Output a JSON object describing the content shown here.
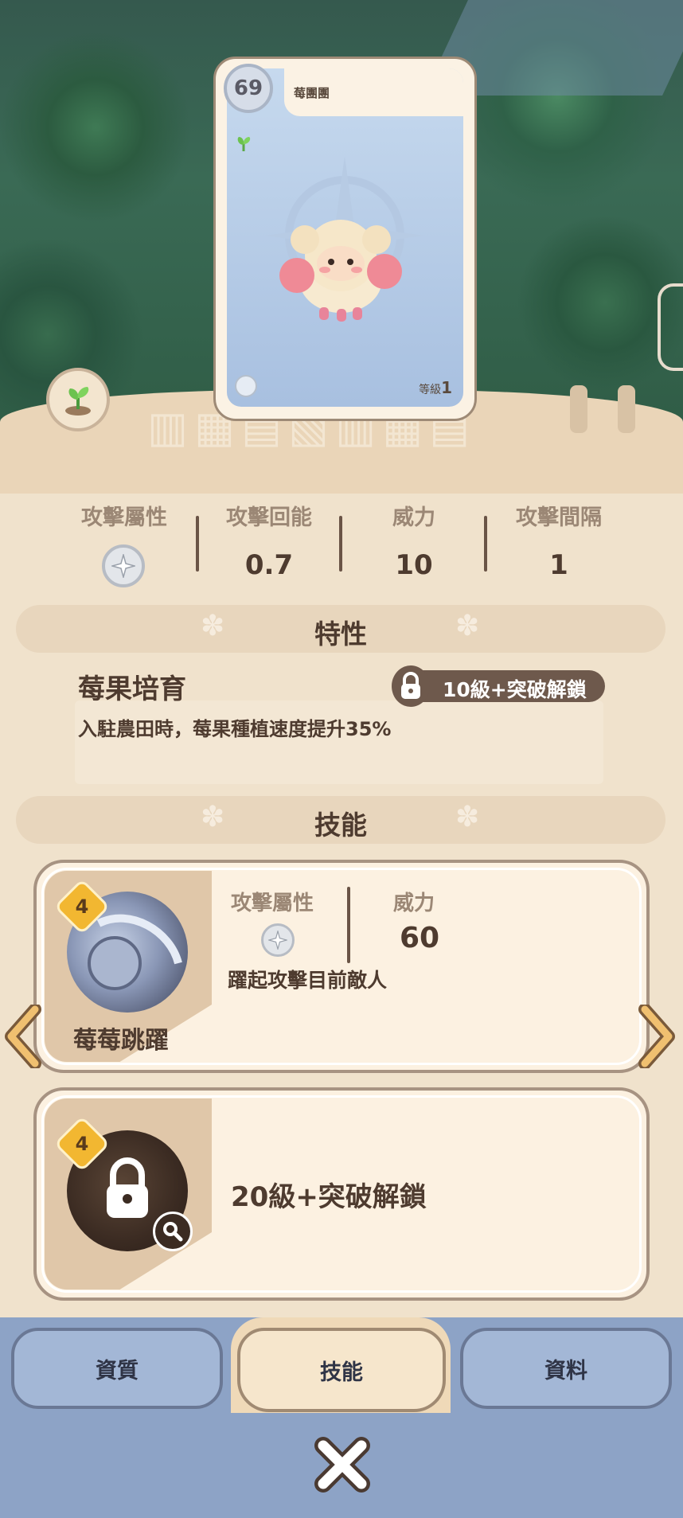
{
  "card": {
    "level": "69",
    "name": "莓團團",
    "level_label": "等級",
    "level_value": "1"
  },
  "stats": {
    "attack_attr_label": "攻擊屬性",
    "energy_label": "攻擊回能",
    "energy_value": "0.7",
    "power_label": "威力",
    "power_value": "10",
    "interval_label": "攻擊間隔",
    "interval_value": "1"
  },
  "traits": {
    "section_title": "特性",
    "name": "莓果培育",
    "unlock": "10級+突破解鎖",
    "desc": "入駐農田時，莓果種植速度提升35%"
  },
  "skills": {
    "section_title": "技能",
    "skill1": {
      "badge": "4",
      "name": "莓莓跳躍",
      "attr_label": "攻擊屬性",
      "power_label": "威力",
      "power_value": "60",
      "desc": "躍起攻擊目前敵人"
    },
    "skill2": {
      "badge": "4",
      "unlock": "20級+突破解鎖"
    }
  },
  "tabs": {
    "aptitude": "資質",
    "skills": "技能",
    "info": "資料"
  },
  "colors": {
    "accent_brown": "#4e3b2f",
    "badge_gold": "#f2b731",
    "tab_blue": "#a3b7d6"
  }
}
